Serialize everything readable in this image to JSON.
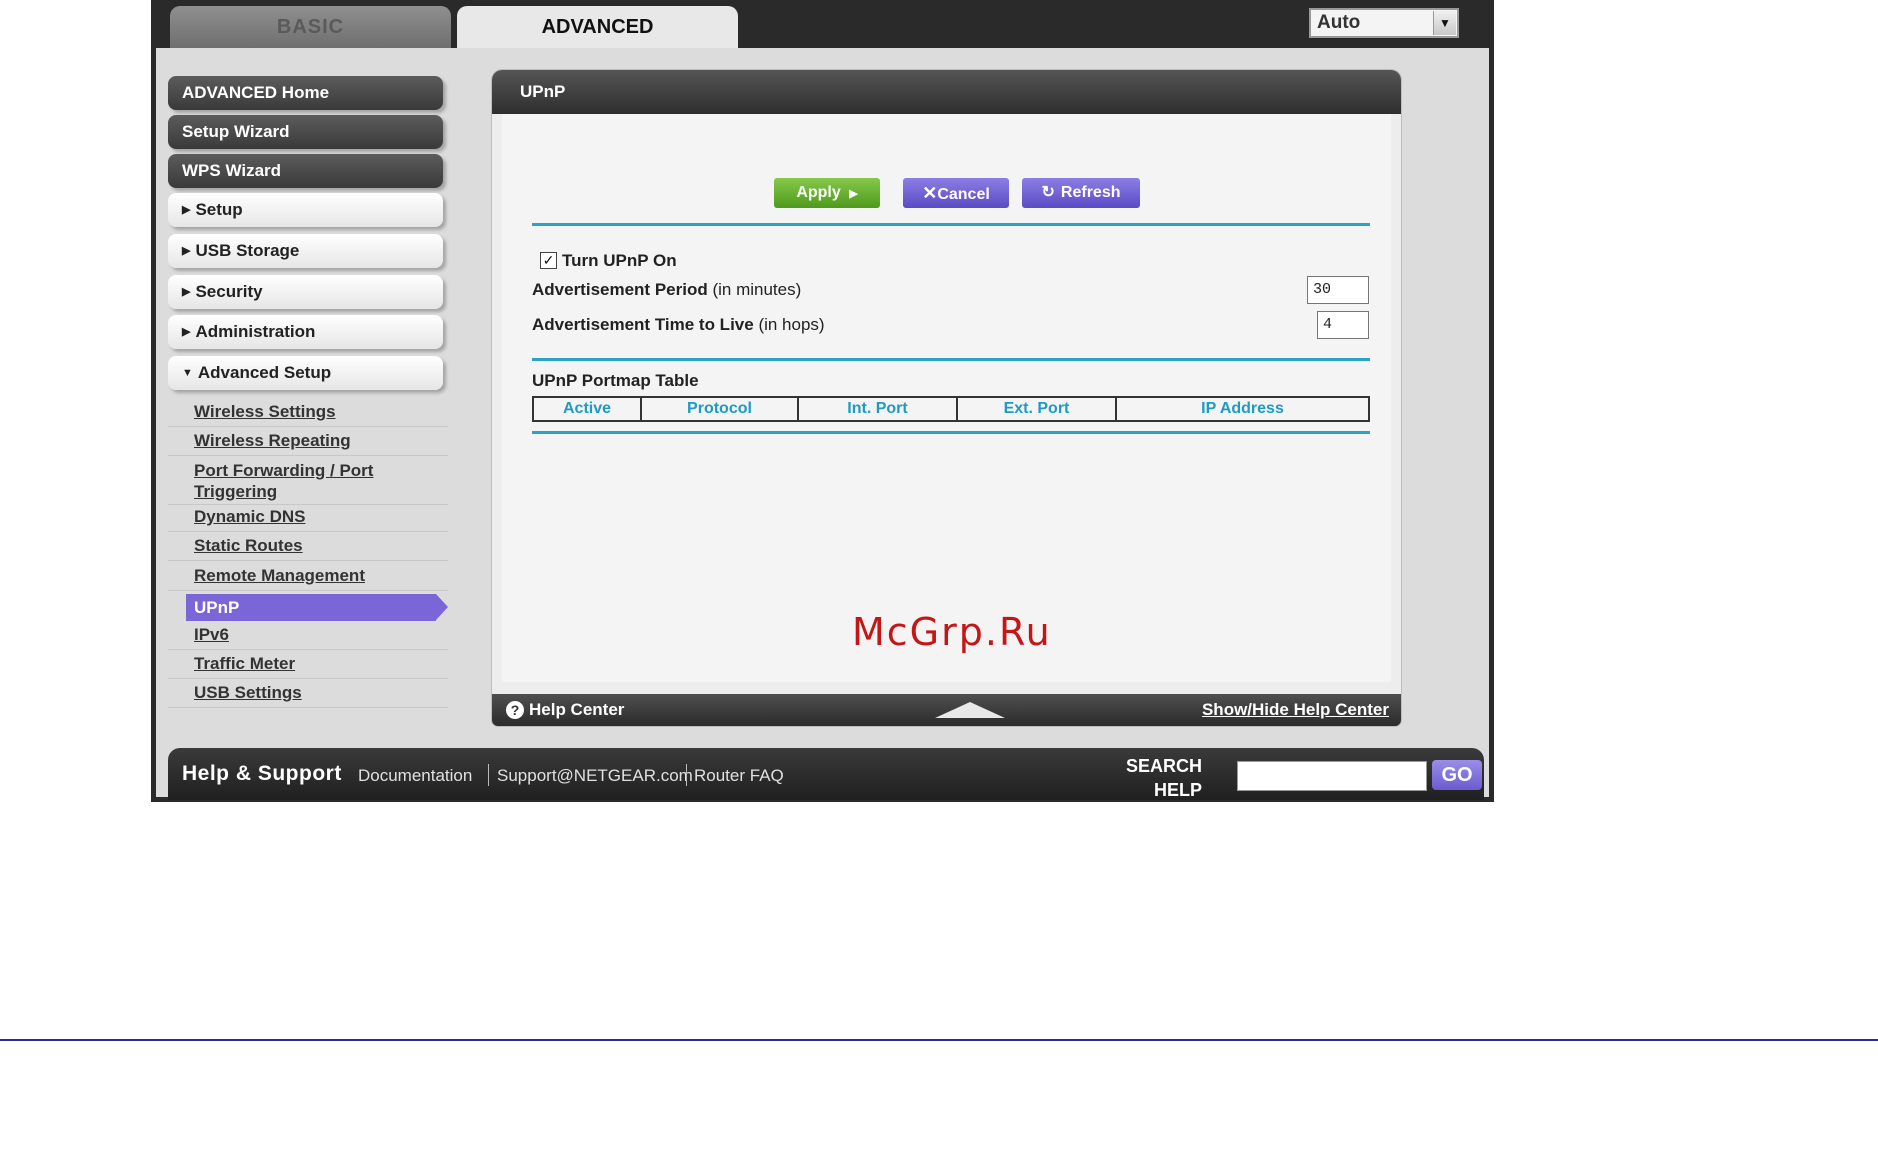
{
  "tabs": {
    "basic": "BASIC",
    "advanced": "ADVANCED"
  },
  "language": {
    "selected": "Auto"
  },
  "sidebar": {
    "main_items": [
      "ADVANCED Home",
      "Setup Wizard",
      "WPS Wizard"
    ],
    "sections": [
      "Setup",
      "USB Storage",
      "Security",
      "Administration",
      "Advanced Setup"
    ],
    "sub_items": [
      "Wireless Settings",
      "Wireless Repeating",
      "Port Forwarding / Port Triggering",
      "Dynamic DNS",
      "Static Routes",
      "Remote Management",
      "UPnP",
      "IPv6",
      "Traffic Meter",
      "USB Settings"
    ]
  },
  "panel": {
    "title": "UPnP",
    "buttons": {
      "apply": "Apply",
      "cancel": "Cancel",
      "refresh": "Refresh"
    },
    "upnp_on_label": "Turn UPnP On",
    "upnp_on_checked": true,
    "ad_period": {
      "label": "Advertisement Period",
      "unit": "(in minutes)",
      "value": "30"
    },
    "ad_ttl": {
      "label": "Advertisement Time to Live",
      "unit": "(in hops)",
      "value": "4"
    },
    "portmap": {
      "title": "UPnP Portmap Table",
      "columns": [
        "Active",
        "Protocol",
        "Int. Port",
        "Ext. Port",
        "IP Address"
      ]
    },
    "watermark": "McGrp.Ru",
    "help_center": "Help Center",
    "show_hide": "Show/Hide Help Center"
  },
  "footer": {
    "title": "Help & Support",
    "links": [
      "Documentation",
      "Support@NETGEAR.com",
      "Router FAQ"
    ],
    "search_label_1": "SEARCH",
    "search_label_2": "HELP",
    "go": "GO"
  },
  "colors": {
    "accent_purple": "#7a66d6",
    "apply_green": "#4e9a1c",
    "rule_blue": "#2aa3c6",
    "header_dark": "#2e2e2e"
  }
}
